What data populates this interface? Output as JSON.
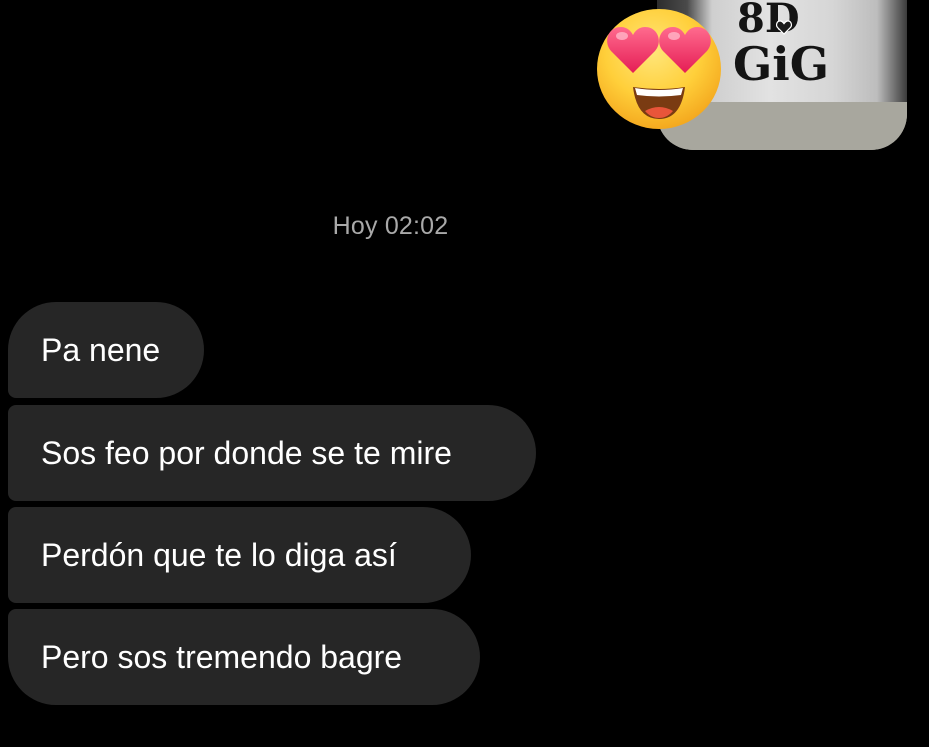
{
  "conversation": {
    "sent_message": {
      "type": "image",
      "reaction_icon": "heart-eyes-emoji",
      "overlay_icon": "heart-icon"
    },
    "timestamp": "Hoy 02:02",
    "received_messages": [
      {
        "text": "Pa nene"
      },
      {
        "text": "Sos feo por donde se te mire"
      },
      {
        "text": "Perdón que te lo diga así"
      },
      {
        "text": "Pero sos tremendo bagre"
      }
    ]
  },
  "colors": {
    "background": "#000000",
    "bubble_received": "#262626",
    "text_primary": "#ffffff",
    "timestamp_text": "#a9a9a9",
    "image_frame": "#a8a79e"
  }
}
